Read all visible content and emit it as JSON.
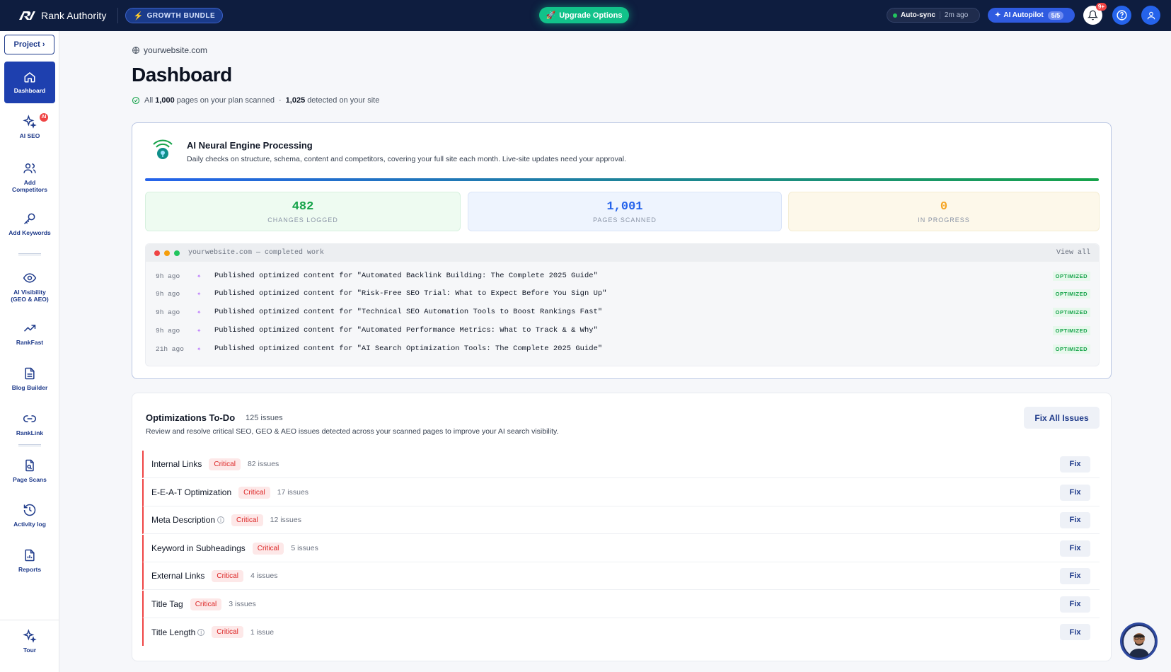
{
  "topbar": {
    "brand": "Rank Authority",
    "bundle": "GROWTH BUNDLE",
    "upgrade": "Upgrade Options",
    "autosync_label": "Auto-sync",
    "autosync_time": "2m ago",
    "autopilot_label": "AI Autopilot",
    "autopilot_count": "5/5",
    "notif_badge": "9+"
  },
  "sidebar": {
    "project": "Project ›",
    "items": [
      {
        "label": "Dashboard",
        "icon": "home-icon"
      },
      {
        "label": "AI SEO",
        "icon": "sparkle-icon",
        "badge": "AI"
      },
      {
        "label": "Add Competitors",
        "icon": "users-icon"
      },
      {
        "label": "Add Keywords",
        "icon": "key-icon"
      },
      {
        "label": "AI Visibility (GEO & AEO)",
        "icon": "eye-icon"
      },
      {
        "label": "RankFast",
        "icon": "trend-up-icon"
      },
      {
        "label": "Blog Builder",
        "icon": "document-icon"
      },
      {
        "label": "RankLink",
        "icon": "link-icon"
      },
      {
        "label": "Page Scans",
        "icon": "page-scan-icon"
      },
      {
        "label": "Activity log",
        "icon": "history-icon"
      },
      {
        "label": "Reports",
        "icon": "report-icon"
      },
      {
        "label": "Tour",
        "icon": "sparkle-icon"
      }
    ]
  },
  "header": {
    "site": "yourwebsite.com",
    "title": "Dashboard",
    "sub_all": "All",
    "sub_pages": "1,000",
    "sub_mid": "pages on your plan scanned",
    "sub_dot": "·",
    "sub_detected": "1,025",
    "sub_end": "detected on your site"
  },
  "engine": {
    "title": "AI Neural Engine Processing",
    "subtitle": "Daily checks on structure, schema, content and competitors, covering your full site each month. Live-site updates need your approval.",
    "progress": 1.0,
    "stats": [
      {
        "value": "482",
        "label": "CHANGES LOGGED"
      },
      {
        "value": "1,001",
        "label": "PAGES SCANNED"
      },
      {
        "value": "0",
        "label": "IN PROGRESS"
      }
    ],
    "terminal_title": "yourwebsite.com — completed work",
    "view_all": "View all",
    "log": [
      {
        "time": "9h ago",
        "text": "Published optimized content for \"Automated Backlink Building: The Complete 2025 Guide\"",
        "status": "OPTIMIZED"
      },
      {
        "time": "9h ago",
        "text": "Published optimized content for \"Risk-Free SEO Trial: What to Expect Before You Sign Up\"",
        "status": "OPTIMIZED"
      },
      {
        "time": "9h ago",
        "text": "Published optimized content for \"Technical SEO Automation Tools to Boost Rankings Fast\"",
        "status": "OPTIMIZED"
      },
      {
        "time": "9h ago",
        "text": "Published optimized content for \"Automated Performance Metrics: What to Track & & Why\"",
        "status": "OPTIMIZED"
      },
      {
        "time": "21h ago",
        "text": "Published optimized content for \"AI Search Optimization Tools: The Complete 2025 Guide\"",
        "status": "OPTIMIZED"
      }
    ]
  },
  "todo": {
    "title": "Optimizations To-Do",
    "count": "125 issues",
    "subtitle": "Review and resolve critical SEO, GEO & AEO issues detected across your scanned pages to improve your AI search visibility.",
    "fix_all": "Fix All Issues",
    "fix_label": "Fix",
    "issues": [
      {
        "name": "Internal Links",
        "severity": "Critical",
        "count": "82 issues",
        "info": false
      },
      {
        "name": "E-E-A-T Optimization",
        "severity": "Critical",
        "count": "17 issues",
        "info": false
      },
      {
        "name": "Meta Description",
        "severity": "Critical",
        "count": "12 issues",
        "info": true
      },
      {
        "name": "Keyword in Subheadings",
        "severity": "Critical",
        "count": "5 issues",
        "info": false
      },
      {
        "name": "External Links",
        "severity": "Critical",
        "count": "4 issues",
        "info": false
      },
      {
        "name": "Title Tag",
        "severity": "Critical",
        "count": "3 issues",
        "info": false
      },
      {
        "name": "Title Length",
        "severity": "Critical",
        "count": "1 issue",
        "info": true
      }
    ]
  },
  "colors": {
    "topbar": "#0e1d3f",
    "accent": "#1e40af",
    "success": "#16a34a",
    "critical": "#dc2626"
  }
}
